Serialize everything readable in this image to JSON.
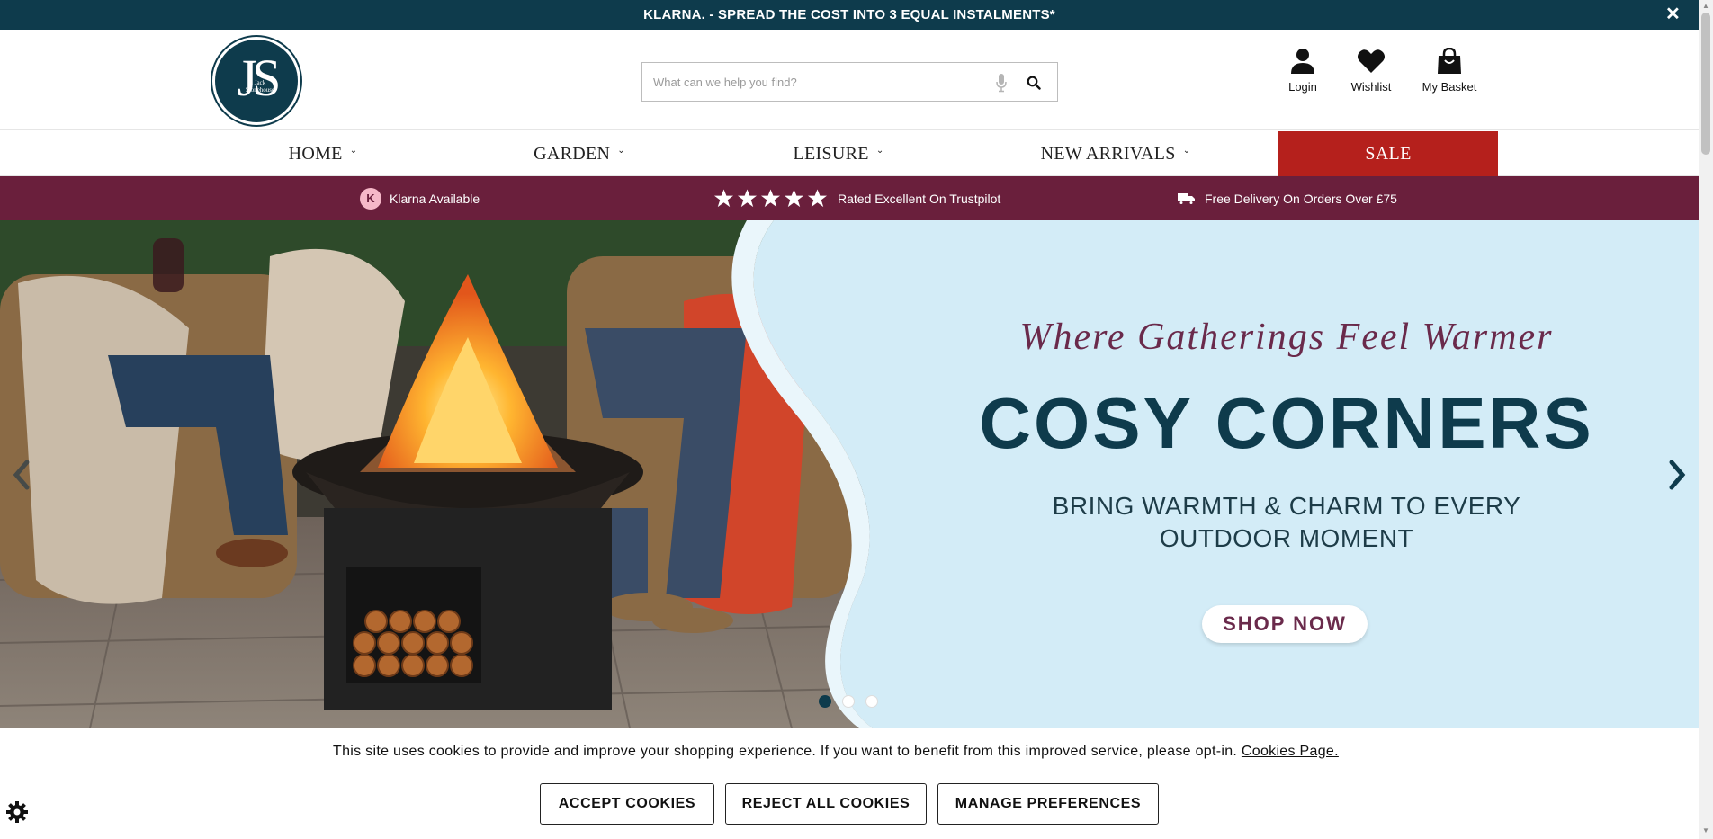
{
  "promo": {
    "text": "KLARNA. - SPREAD THE COST INTO 3 EQUAL INSTALMENTS*",
    "close": "✕"
  },
  "header": {
    "logo": {
      "letters": "JS",
      "sub": "Jack Stonehouse"
    },
    "search": {
      "placeholder": "What can we help you find?",
      "value": ""
    },
    "login": "Login",
    "wishlist": "Wishlist",
    "basket": "My Basket"
  },
  "nav": {
    "home": "HOME",
    "garden": "GARDEN",
    "leisure": "LEISURE",
    "new_arrivals": "NEW ARRIVALS",
    "sale": "SALE",
    "chevron": "⌄"
  },
  "usp": {
    "klarna_badge": "K",
    "klarna": "Klarna Available",
    "trustpilot": "Rated Excellent On Trustpilot",
    "delivery": "Free Delivery On Orders Over £75",
    "star_count": 5
  },
  "hero": {
    "tagline": "Where Gatherings Feel Warmer",
    "title": "COSY CORNERS",
    "sub_line1": "BRING WARMTH & CHARM TO EVERY",
    "sub_line2": "OUTDOOR MOMENT",
    "cta": "SHOP NOW",
    "slide_count": 3,
    "active_slide": 1
  },
  "cookie": {
    "text": "This site uses cookies to provide and improve your shopping experience. If you want to benefit from this improved service, please opt-in.",
    "link": "Cookies Page.",
    "accept": "ACCEPT COOKIES",
    "reject": "REJECT ALL COOKIES",
    "manage": "MANAGE PREFERENCES"
  },
  "colors": {
    "brand_navy": "#0e3b4c",
    "usp_plum": "#6a1f3c",
    "sale_red": "#b5201c",
    "hero_sky": "#d3ecf7"
  },
  "icons": [
    "close-icon",
    "microphone-icon",
    "search-icon",
    "user-icon",
    "heart-icon",
    "shopping-bag-icon",
    "klarna-icon",
    "star-icon",
    "truck-icon",
    "chevron-left-icon",
    "chevron-right-icon",
    "gear-icon"
  ]
}
